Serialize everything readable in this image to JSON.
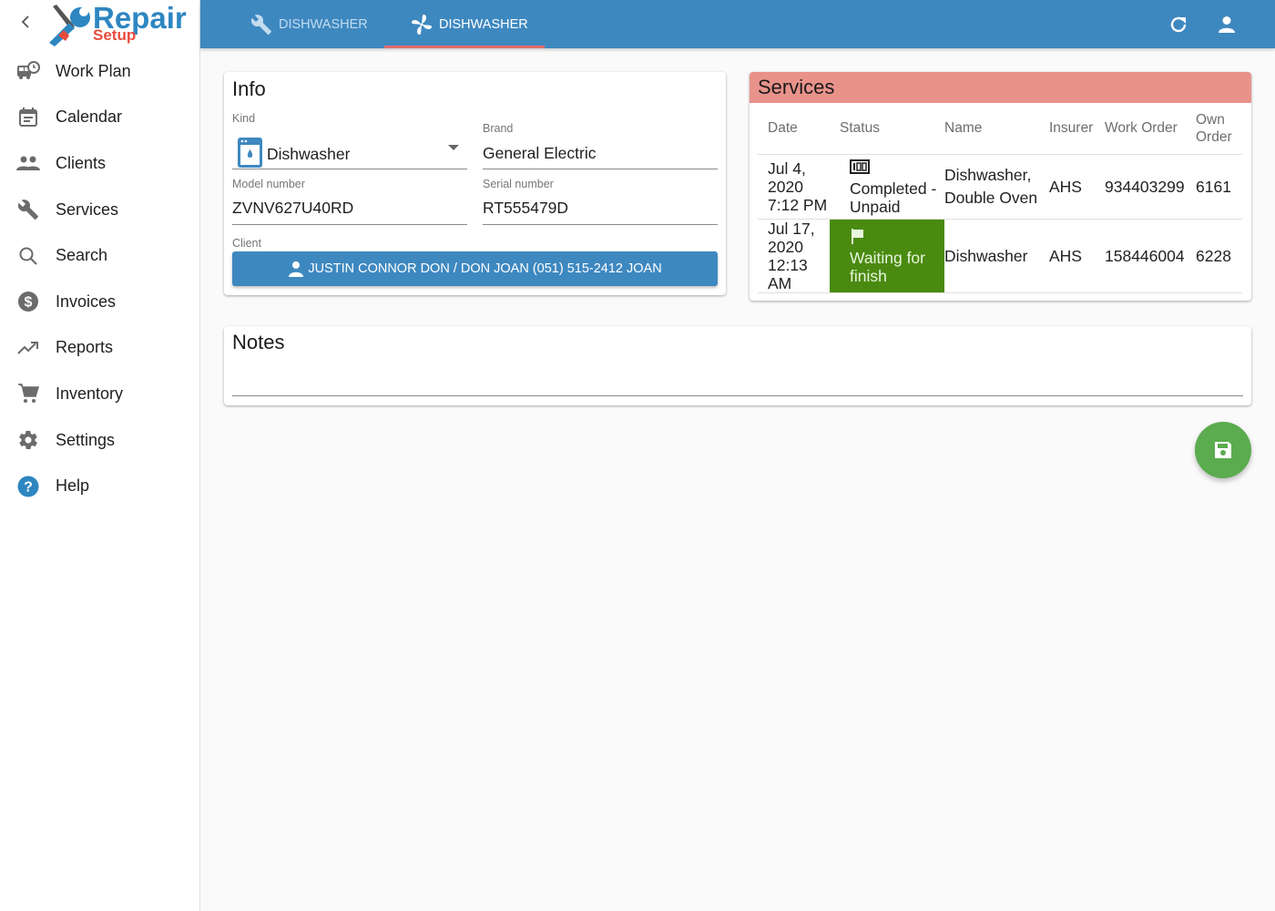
{
  "app": {
    "logo_word_1": "Repair",
    "logo_word_2": "Setup",
    "back_icon": "chevron-left-icon"
  },
  "sidebar": {
    "items": [
      {
        "label": "Work Plan",
        "icon": "truck-clock-icon"
      },
      {
        "label": "Calendar",
        "icon": "calendar-icon"
      },
      {
        "label": "Clients",
        "icon": "people-icon"
      },
      {
        "label": "Services",
        "icon": "wrench-icon"
      },
      {
        "label": "Search",
        "icon": "search-icon"
      },
      {
        "label": "Invoices",
        "icon": "dollar-circle-icon"
      },
      {
        "label": "Reports",
        "icon": "trending-up-icon"
      },
      {
        "label": "Inventory",
        "icon": "cart-icon"
      },
      {
        "label": "Settings",
        "icon": "gear-icon"
      },
      {
        "label": "Help",
        "icon": "help-circle-icon"
      }
    ]
  },
  "topbar": {
    "tabs": [
      {
        "label": "DISHWASHER",
        "icon": "wrench-icon",
        "active": false
      },
      {
        "label": "DISHWASHER",
        "icon": "fan-icon",
        "active": true
      }
    ],
    "actions": [
      {
        "name": "refresh",
        "icon": "refresh-icon"
      },
      {
        "name": "account",
        "icon": "account-icon"
      }
    ],
    "accent_underline": "#e06b6b"
  },
  "info": {
    "title": "Info",
    "kind": {
      "label": "Kind",
      "value": "Dishwasher",
      "icon": "dishwasher-icon"
    },
    "brand": {
      "label": "Brand",
      "value": "General Electric"
    },
    "model_number": {
      "label": "Model number",
      "value": "ZVNV627U40RD"
    },
    "serial_number": {
      "label": "Serial number",
      "value": "RT555479D"
    },
    "client": {
      "label": "Client",
      "button_label": "JUSTIN CONNOR DON / DON JOAN (051) 515-2412 JOAN",
      "icon": "person-icon"
    }
  },
  "services": {
    "title": "Services",
    "header_color": "#e8928a",
    "columns": [
      "Date",
      "Status",
      "Name",
      "Insurer",
      "Work Order",
      "Own Order"
    ],
    "rows": [
      {
        "date_line_1": "Jul 4,",
        "date_line_2": "2020",
        "date_line_3": "7:12 PM",
        "date_line_4": "",
        "status": "Completed - Unpaid",
        "status_icon": "counter-100-icon",
        "status_color": "",
        "name": "Dishwasher, Double Oven",
        "insurer": "AHS",
        "work_order": "934403299",
        "own_order": "6161"
      },
      {
        "date_line_1": "Jul 17,",
        "date_line_2": "2020",
        "date_line_3": "12:13",
        "date_line_4": "AM",
        "status": "Waiting for finish",
        "status_icon": "flag-icon",
        "status_color": "#4a8a10",
        "name": "Dishwasher",
        "insurer": "AHS",
        "work_order": "158446004",
        "own_order": "6228"
      }
    ]
  },
  "notes": {
    "title": "Notes",
    "value": ""
  },
  "fab": {
    "name": "save",
    "icon": "floppy-disk-icon",
    "color": "#5bab4f"
  }
}
